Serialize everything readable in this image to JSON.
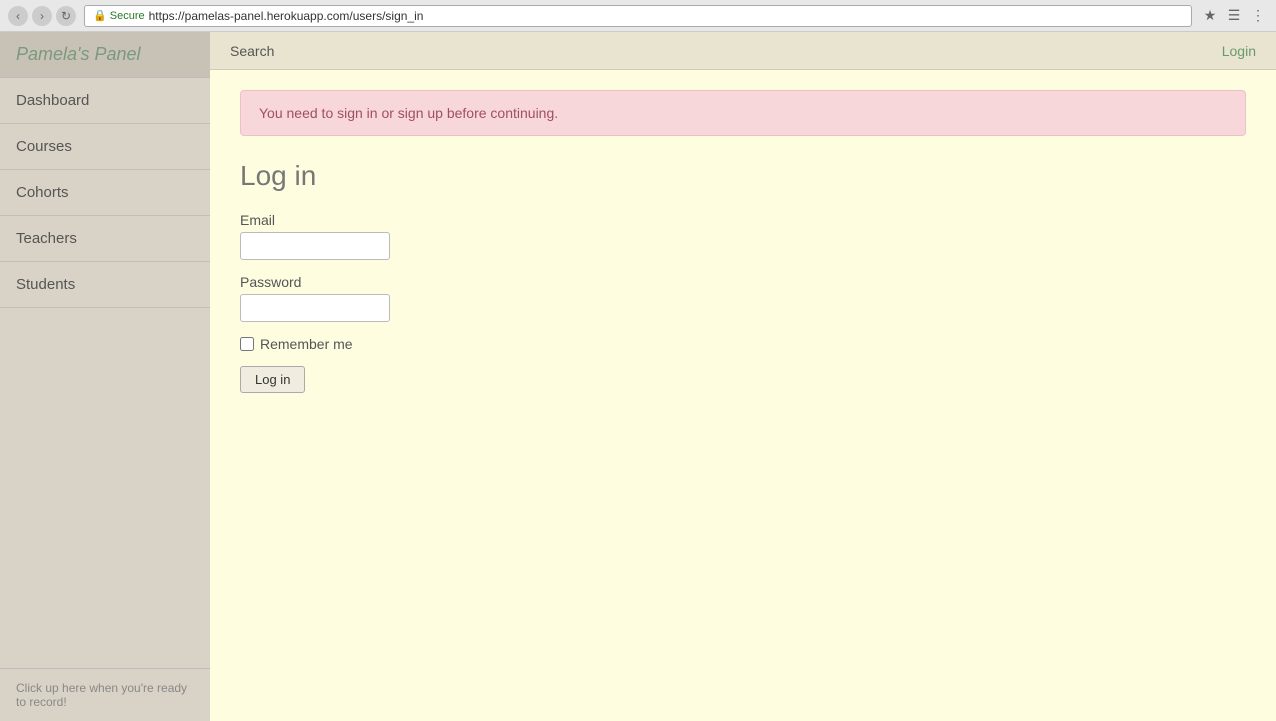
{
  "browser": {
    "url": "https://pamelas-panel.herokuapp.com/users/sign_in",
    "secure_label": "Secure",
    "url_display": "https://pamelas-panel.herokuapp.com/users/sign_in"
  },
  "sidebar": {
    "brand": "Pamela's Panel",
    "items": [
      {
        "label": "Dashboard",
        "id": "dashboard"
      },
      {
        "label": "Courses",
        "id": "courses"
      },
      {
        "label": "Cohorts",
        "id": "cohorts"
      },
      {
        "label": "Teachers",
        "id": "teachers"
      },
      {
        "label": "Students",
        "id": "students"
      }
    ],
    "footer_text": "Click up here when you're ready to record!"
  },
  "topnav": {
    "search_label": "Search",
    "login_label": "Login"
  },
  "alert": {
    "message": "You need to sign in or sign up before continuing."
  },
  "form": {
    "title": "Log in",
    "email_label": "Email",
    "email_placeholder": "",
    "password_label": "Password",
    "password_placeholder": "",
    "remember_me_label": "Remember me",
    "submit_label": "Log in"
  }
}
